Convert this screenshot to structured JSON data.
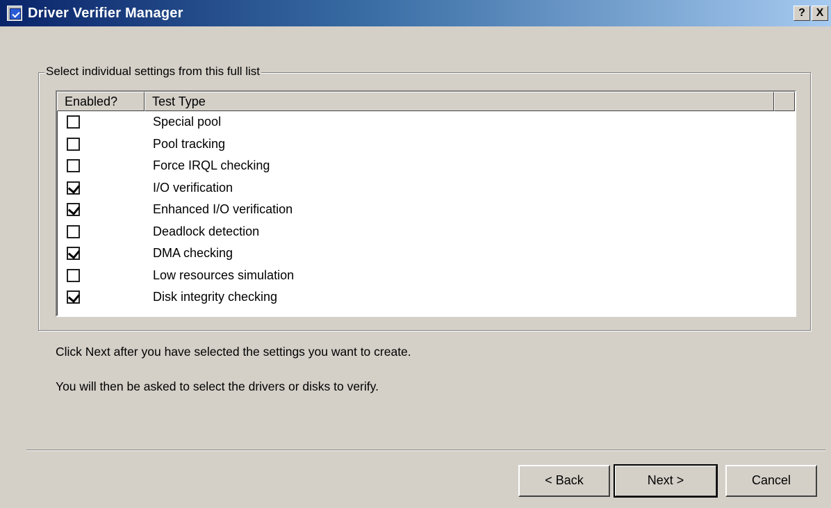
{
  "window": {
    "title": "Driver Verifier Manager",
    "help_button": "?",
    "close_button": "X"
  },
  "group": {
    "legend": "Select individual settings from this full list"
  },
  "list": {
    "columns": [
      "Enabled?",
      "Test Type"
    ],
    "rows": [
      {
        "enabled": false,
        "label": "Special pool"
      },
      {
        "enabled": false,
        "label": "Pool tracking"
      },
      {
        "enabled": false,
        "label": "Force IRQL checking"
      },
      {
        "enabled": true,
        "label": "I/O verification"
      },
      {
        "enabled": true,
        "label": "Enhanced I/O verification"
      },
      {
        "enabled": false,
        "label": "Deadlock detection"
      },
      {
        "enabled": true,
        "label": "DMA checking"
      },
      {
        "enabled": false,
        "label": "Low resources simulation"
      },
      {
        "enabled": true,
        "label": "Disk integrity checking"
      }
    ]
  },
  "instructions": {
    "line1": "Click Next after you have selected the settings you want to create.",
    "line2": "You will then be asked to select the drivers or disks to verify."
  },
  "buttons": {
    "back": "< Back",
    "next": "Next >",
    "cancel": "Cancel"
  },
  "colors": {
    "titlebar_start": "#0a246a",
    "titlebar_end": "#a6caf0",
    "face": "#d4d0c8"
  }
}
